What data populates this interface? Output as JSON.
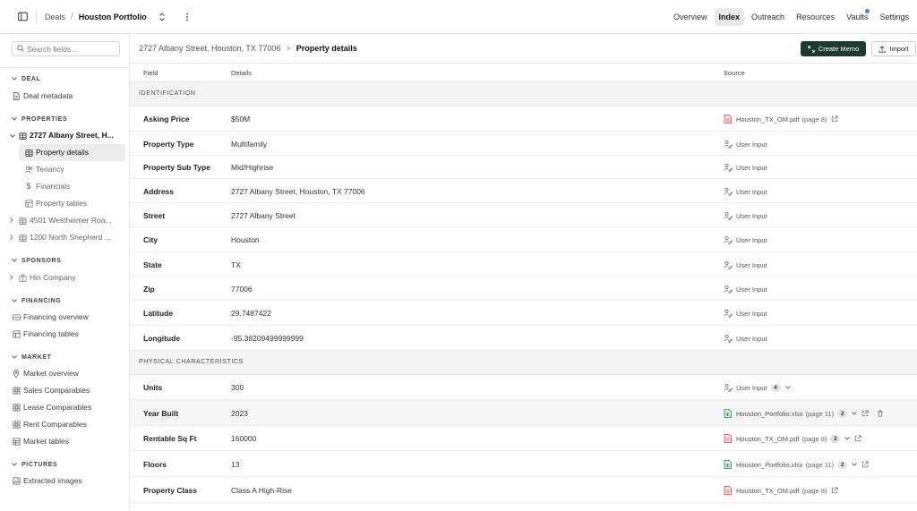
{
  "topbar": {
    "breadcrumb_root": "Deals",
    "breadcrumb_sep": "/",
    "breadcrumb_current": "Houston Portfolio",
    "nav": [
      {
        "label": "Overview",
        "active": false,
        "badge": false
      },
      {
        "label": "Index",
        "active": true,
        "badge": false
      },
      {
        "label": "Outreach",
        "active": false,
        "badge": false
      },
      {
        "label": "Resources",
        "active": false,
        "badge": false
      },
      {
        "label": "Vaults",
        "active": false,
        "badge": true
      },
      {
        "label": "Settings",
        "active": false,
        "badge": false
      }
    ],
    "badge_color": "#3b82f6"
  },
  "sidebar": {
    "search_placeholder": "Search fields...",
    "sections": {
      "deal": "DEAL",
      "properties": "PROPERTIES",
      "sponsors": "SPONSORS",
      "financing": "FINANCING",
      "market": "MARKET",
      "pictures": "PICTURES"
    },
    "items": {
      "deal_metadata": "Deal metadata",
      "property_1": "2727 Albany Street, H...",
      "property_details": "Property details",
      "tenancy": "Tenancy",
      "financials": "Financials",
      "property_tables": "Property tables",
      "property_2": "4501 Westheimer Roa...",
      "property_3": "1200 North Shepherd ...",
      "hin_company": "Hin Company",
      "financing_overview": "Financing overview",
      "financing_tables": "Financing tables",
      "market_overview": "Market overview",
      "sales_comparables": "Sales Comparables",
      "lease_comparables": "Lease Comparables",
      "rent_comparables": "Rent Comparables",
      "market_tables": "Market tables",
      "extracted_images": "Extracted images"
    }
  },
  "main": {
    "breadcrumb_address": "2727 Albany Street, Houston, TX 77006",
    "breadcrumb_sep": ">",
    "breadcrumb_current": "Property details",
    "create_memo_label": "Create Memo",
    "import_label": "Import",
    "accent_color": "#1d3b30",
    "columns": {
      "field": "Field",
      "details": "Details",
      "source": "Source"
    },
    "groups": {
      "identification": "IDENTIFICATION",
      "physical": "PHYSICAL CHARACTERISTICS"
    },
    "identification_rows": [
      {
        "field": "Asking Price",
        "details": "$50M",
        "source_type": "pdf",
        "source": "Houston_TX_OM.pdf",
        "page": "(page 8)",
        "count": "",
        "chevron": false,
        "external": true,
        "trash": false
      },
      {
        "field": "Property Type",
        "details": "Multifamily",
        "source_type": "user",
        "source": "User Input",
        "page": "",
        "count": "",
        "chevron": false,
        "external": false,
        "trash": false
      },
      {
        "field": "Property Sub Type",
        "details": "Mid/Highrise",
        "source_type": "user",
        "source": "User Input",
        "page": "",
        "count": "",
        "chevron": false,
        "external": false,
        "trash": false
      },
      {
        "field": "Address",
        "details": "2727 Albany Street, Houston, TX 77006",
        "source_type": "user",
        "source": "User Input",
        "page": "",
        "count": "",
        "chevron": false,
        "external": false,
        "trash": false
      },
      {
        "field": "Street",
        "details": "2727 Albany Street",
        "source_type": "user",
        "source": "User Input",
        "page": "",
        "count": "",
        "chevron": false,
        "external": false,
        "trash": false
      },
      {
        "field": "City",
        "details": "Houston",
        "source_type": "user",
        "source": "User Input",
        "page": "",
        "count": "",
        "chevron": false,
        "external": false,
        "trash": false
      },
      {
        "field": "State",
        "details": "TX",
        "source_type": "user",
        "source": "User Input",
        "page": "",
        "count": "",
        "chevron": false,
        "external": false,
        "trash": false
      },
      {
        "field": "Zip",
        "details": "77006",
        "source_type": "user",
        "source": "User Input",
        "page": "",
        "count": "",
        "chevron": false,
        "external": false,
        "trash": false
      },
      {
        "field": "Latitude",
        "details": "29.7487422",
        "source_type": "user",
        "source": "User Input",
        "page": "",
        "count": "",
        "chevron": false,
        "external": false,
        "trash": false
      },
      {
        "field": "Longitude",
        "details": "-95.38209499999999",
        "source_type": "user",
        "source": "User Input",
        "page": "",
        "count": "",
        "chevron": false,
        "external": false,
        "trash": false
      }
    ],
    "physical_rows": [
      {
        "field": "Units",
        "details": "300",
        "source_type": "user",
        "source": "User Input",
        "page": "",
        "count": "4",
        "chevron": true,
        "external": false,
        "trash": false
      },
      {
        "field": "Year Built",
        "details": "2023",
        "source_type": "xlsx",
        "source": "Houston_Portfolio.xlsx",
        "page": "(page 11)",
        "count": "2",
        "chevron": true,
        "external": true,
        "trash": true
      },
      {
        "field": "Rentable Sq Ft",
        "details": "160000",
        "source_type": "pdf",
        "source": "Houston_TX_OM.pdf",
        "page": "(page 8)",
        "count": "2",
        "chevron": true,
        "external": true,
        "trash": false
      },
      {
        "field": "Floors",
        "details": "13",
        "source_type": "xlsx",
        "source": "Houston_Portfolio.xlsx",
        "page": "(page 11)",
        "count": "2",
        "chevron": true,
        "external": true,
        "trash": false
      },
      {
        "field": "Property Class",
        "details": "Class A High-Rise",
        "source_type": "pdf",
        "source": "Houston_TX_OM.pdf",
        "page": "(page 8)",
        "count": "",
        "chevron": false,
        "external": true,
        "trash": false
      }
    ]
  }
}
